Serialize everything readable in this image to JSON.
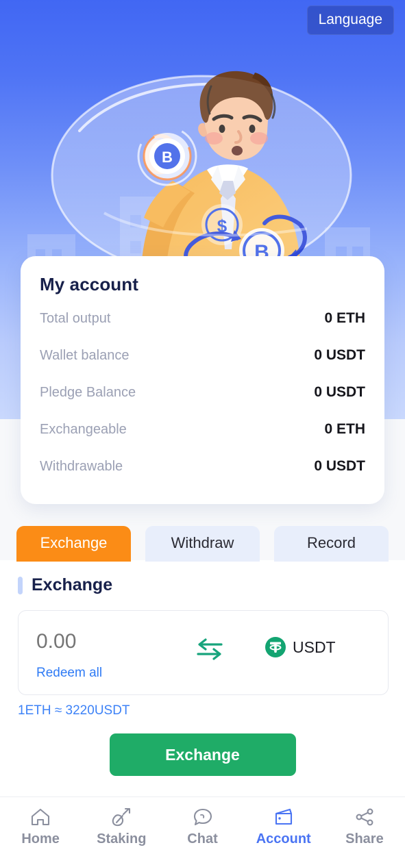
{
  "header": {
    "language_button": "Language",
    "hero_illustration": "crypto-exchange-illustration",
    "gradient_top": "#4167f3",
    "gradient_bottom": "#c9d8fd"
  },
  "account": {
    "title": "My account",
    "rows": [
      {
        "label": "Total output",
        "value": "0 ETH"
      },
      {
        "label": "Wallet balance",
        "value": "0 USDT"
      },
      {
        "label": "Pledge Balance",
        "value": "0 USDT"
      },
      {
        "label": "Exchangeable",
        "value": "0 ETH"
      },
      {
        "label": "Withdrawable",
        "value": "0 USDT"
      }
    ]
  },
  "tabs": {
    "items": [
      {
        "label": "Exchange",
        "active": true
      },
      {
        "label": "Withdraw",
        "active": false
      },
      {
        "label": "Record",
        "active": false
      }
    ],
    "active_color": "#fb8c16",
    "inactive_color": "#e8eefb"
  },
  "panel": {
    "title": "Exchange",
    "amount_value": "0.00",
    "amount_placeholder": "0.00",
    "redeem_all_label": "Redeem all",
    "swap_icon": "swap-arrows-icon",
    "token_icon": "usdt-token-icon",
    "token_name": "USDT",
    "rate_text": "1ETH ≈ 3220USDT",
    "submit_label": "Exchange",
    "submit_color": "#1fac67"
  },
  "bottom_nav": {
    "items": [
      {
        "label": "Home",
        "icon": "home-icon",
        "active": false
      },
      {
        "label": "Staking",
        "icon": "shovel-icon",
        "active": false
      },
      {
        "label": "Chat",
        "icon": "chat-icon",
        "active": false
      },
      {
        "label": "Account",
        "icon": "wallet-icon",
        "active": true
      },
      {
        "label": "Share",
        "icon": "share-icon",
        "active": false
      }
    ],
    "active_color": "#4a74f3",
    "inactive_color": "#8b8f9e"
  }
}
